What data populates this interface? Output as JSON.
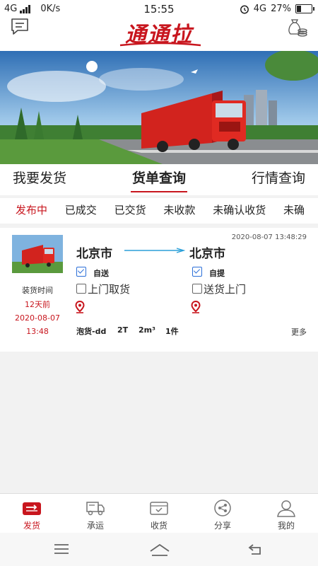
{
  "status_bar": {
    "network": "4G",
    "speed": "0K/s",
    "time": "15:55",
    "network_right": "4G",
    "battery": "27%"
  },
  "header": {
    "logo_text": "通通拉",
    "brand_color": "#c8161e"
  },
  "main_tabs": [
    {
      "label": "我要发货",
      "active": false
    },
    {
      "label": "货单查询",
      "active": true
    },
    {
      "label": "行情查询",
      "active": false
    }
  ],
  "sub_tabs": [
    {
      "label": "发布中",
      "active": true
    },
    {
      "label": "已成交",
      "active": false
    },
    {
      "label": "已交货",
      "active": false
    },
    {
      "label": "未收款",
      "active": false
    },
    {
      "label": "未确认收货",
      "active": false
    },
    {
      "label": "未确",
      "active": false
    }
  ],
  "order": {
    "timestamp": "2020-08-07 13:48:29",
    "load_time_label": "装货时间",
    "load_relative": "12天前",
    "load_date": "2020-08-07",
    "load_time": "13:48",
    "from_city": "北京市",
    "to_city": "北京市",
    "from_option_checked": "自送",
    "from_option_unchecked": "上门取货",
    "to_option_checked": "自提",
    "to_option_unchecked": "送货上门",
    "cargo_type": "泡货-dd",
    "weight": "2T",
    "volume": "2m³",
    "count": "1件",
    "more_label": "更多"
  },
  "bottom_nav": [
    {
      "label": "发货",
      "icon": "truck-card-icon",
      "active": true
    },
    {
      "label": "承运",
      "icon": "delivery-truck-icon",
      "active": false
    },
    {
      "label": "收货",
      "icon": "inbox-check-icon",
      "active": false
    },
    {
      "label": "分享",
      "icon": "share-icon",
      "active": false
    },
    {
      "label": "我的",
      "icon": "user-icon",
      "active": false
    }
  ]
}
